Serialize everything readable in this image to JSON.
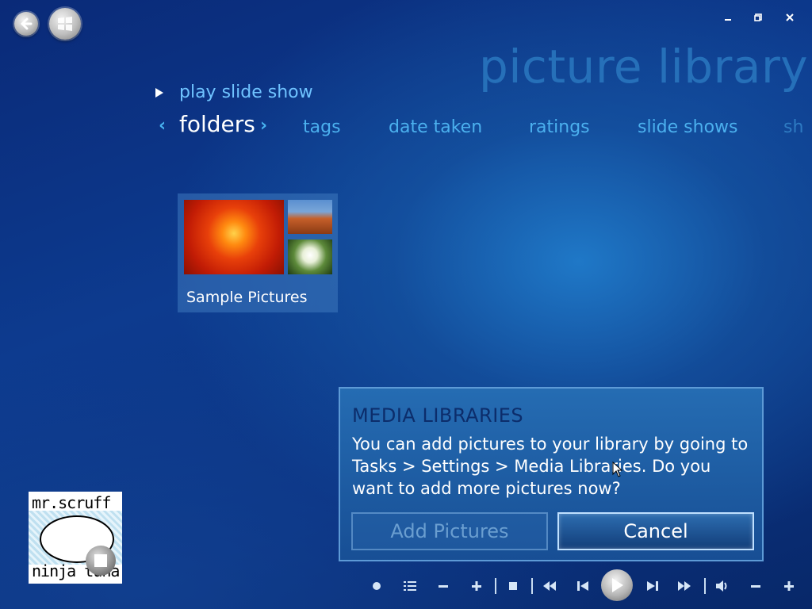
{
  "header": {
    "back_icon": "back-arrow-icon",
    "start_icon": "windows-logo-icon",
    "page_title": "picture library"
  },
  "window_controls": {
    "minimize": "minimize-icon",
    "restore": "restore-icon",
    "close": "close-icon"
  },
  "actions": {
    "play_slide_show": "play slide show"
  },
  "tabs": [
    {
      "label": "folders",
      "active": true
    },
    {
      "label": "tags",
      "active": false
    },
    {
      "label": "date taken",
      "active": false
    },
    {
      "label": "ratings",
      "active": false
    },
    {
      "label": "slide shows",
      "active": false
    },
    {
      "label": "sh",
      "active": false
    }
  ],
  "folders": [
    {
      "label": "Sample Pictures"
    }
  ],
  "dialog": {
    "title": "MEDIA LIBRARIES",
    "body": "You can add pictures to your library by going to Tasks > Settings > Media Libraries. Do you want to add more pictures now?",
    "primary_button": "Add Pictures",
    "secondary_button": "Cancel"
  },
  "now_playing": {
    "album_text_top": "mr.scruff",
    "album_text_bottom": "ninja tuna"
  },
  "transport": {
    "icons": [
      "record-icon",
      "playlist-icon",
      "minus-icon",
      "plus-icon",
      "stop-icon",
      "rewind-icon",
      "previous-icon",
      "play-icon",
      "next-icon",
      "fast-forward-icon",
      "volume-icon",
      "volume-down-icon",
      "volume-up-icon"
    ]
  },
  "colors": {
    "background": "#0b3383",
    "accent": "#4bb0ee",
    "dialog": "#1f62a8"
  }
}
